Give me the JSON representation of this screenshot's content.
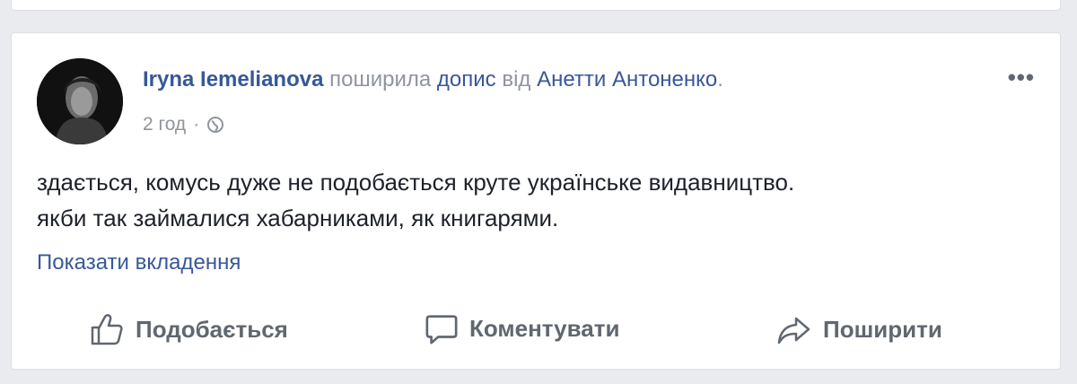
{
  "post": {
    "author": "Iryna Iemelianova",
    "shared_text": "поширила",
    "post_link": "допис",
    "from_text": "від",
    "source_author": "Анетти Антоненко",
    "time": "2 год",
    "meta_separator": "·",
    "body_lines": [
      "здається, комусь дуже не подобається круте українське видавництво.",
      "якби так займалися хабарниками, як книгарями."
    ],
    "attachment_link": "Показати вкладення",
    "more_label": "•••"
  },
  "actions": {
    "like": "Подобається",
    "comment": "Коментувати",
    "share": "Поширити"
  },
  "icons": {
    "like": "thumbs-up-icon",
    "comment": "speech-bubble-icon",
    "share": "share-arrow-icon",
    "privacy": "globe-icon"
  },
  "colors": {
    "link": "#365899",
    "muted": "#90949c",
    "text": "#1d2129",
    "action": "#606770",
    "background": "#e9ebee"
  }
}
